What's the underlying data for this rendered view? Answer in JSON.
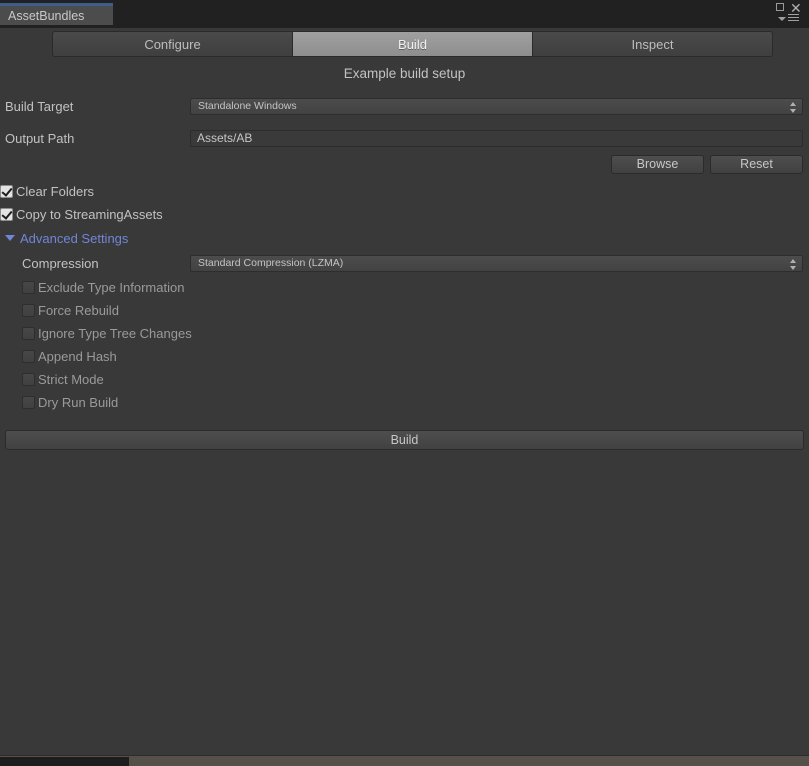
{
  "window": {
    "tab_title": "AssetBundles",
    "controls": {
      "maximize": "maximize-icon",
      "close": "✕",
      "menu": "panel-menu-icon"
    }
  },
  "tabs": [
    {
      "label": "Configure",
      "selected": false
    },
    {
      "label": "Build",
      "selected": true
    },
    {
      "label": "Inspect",
      "selected": false
    }
  ],
  "main": {
    "section_title": "Example build setup",
    "build_target": {
      "label": "Build Target",
      "value": "Standalone Windows"
    },
    "output_path": {
      "label": "Output Path",
      "value": "Assets/AB"
    },
    "buttons": {
      "browse": "Browse",
      "reset": "Reset"
    },
    "options": [
      {
        "label": "Clear Folders",
        "checked": true
      },
      {
        "label": "Copy to StreamingAssets",
        "checked": true
      }
    ],
    "advanced": {
      "label": "Advanced Settings",
      "expanded": true,
      "accent_color": "#7186d6",
      "compression": {
        "label": "Compression",
        "value": "Standard Compression (LZMA)"
      },
      "options": [
        {
          "label": "Exclude Type Information",
          "checked": false
        },
        {
          "label": "Force Rebuild",
          "checked": false
        },
        {
          "label": "Ignore Type Tree Changes",
          "checked": false
        },
        {
          "label": "Append Hash",
          "checked": false
        },
        {
          "label": "Strict Mode",
          "checked": false
        },
        {
          "label": "Dry Run Build",
          "checked": false
        }
      ]
    },
    "build_button": "Build"
  },
  "theme": {
    "background": "#393939",
    "titlebar": "#212121",
    "tab_accent": "#3e5c8c",
    "text": "#c2c2c2"
  }
}
